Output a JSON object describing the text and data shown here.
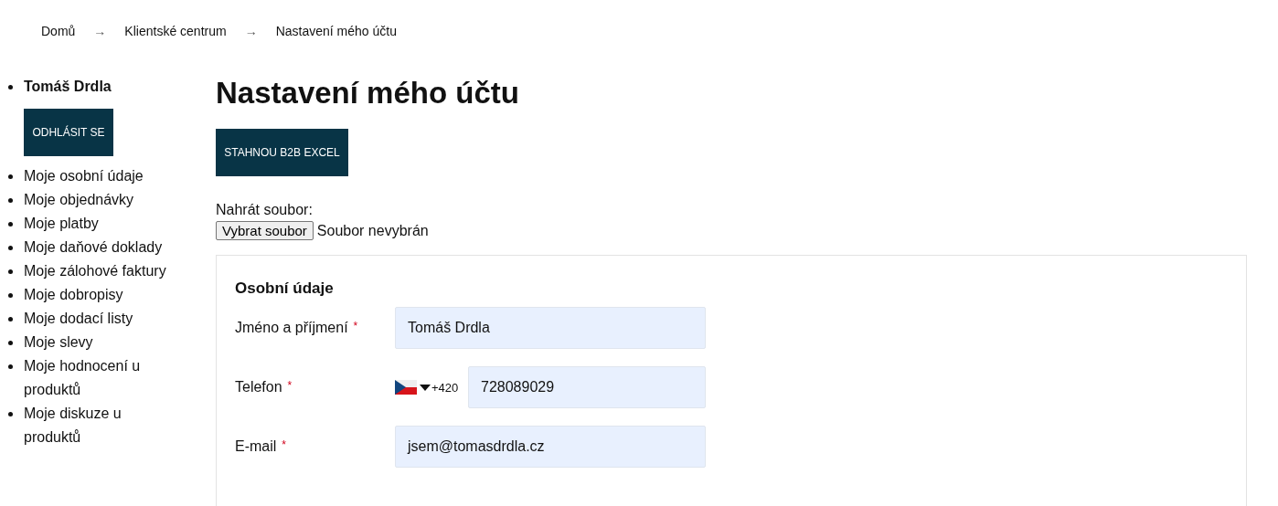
{
  "breadcrumb": [
    {
      "label": "Domů",
      "separator": "→"
    },
    {
      "label": "Klientské centrum",
      "separator": "→"
    },
    {
      "label": "Nastavení mého účtu"
    }
  ],
  "sidebar": {
    "user_name": "Tomáš Drdla",
    "logout_button": "ODHLÁSIT SE",
    "items": [
      "Moje osobní údaje",
      "Moje objednávky",
      "Moje platby",
      "Moje daňové doklady",
      "Moje zálohové faktury",
      "Moje dobropisy",
      "Moje dodací listy",
      "Moje slevy",
      "Moje hodnocení u produktů",
      "Moje diskuze u produktů"
    ]
  },
  "page_title": "Nastavení mého účtu",
  "download_button": "STAHNOU B2B EXCEL",
  "upload": {
    "label": "Nahrát soubor:",
    "button": "Vybrat soubor",
    "status": "Soubor nevybrán"
  },
  "personal_section": {
    "title": "Osobní údaje",
    "fields": [
      {
        "kind": "text",
        "label": "Jméno a příjmení",
        "required_mark": "*",
        "value": "Tomáš Drdla"
      },
      {
        "kind": "phone",
        "label": "Telefon",
        "required_mark": "*",
        "prefix": "+420",
        "value": "728089029"
      },
      {
        "kind": "text",
        "label": "E-mail",
        "required_mark": "*",
        "value": "jsem@tomasdrdla.cz"
      }
    ]
  }
}
